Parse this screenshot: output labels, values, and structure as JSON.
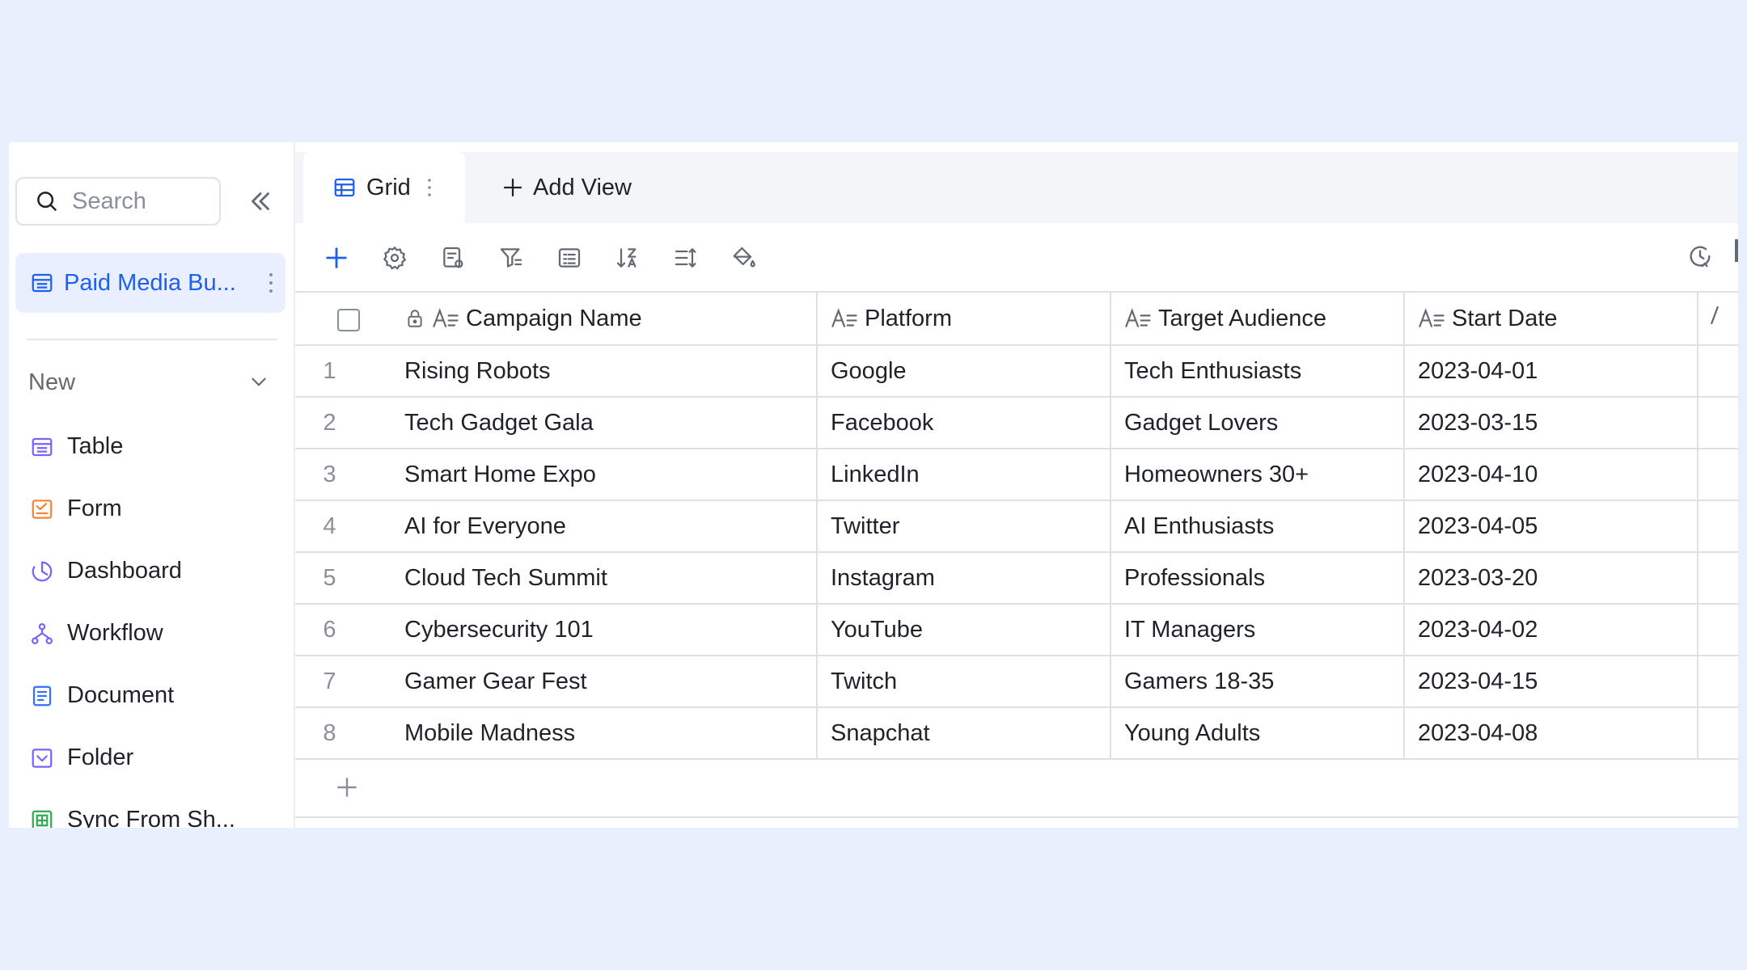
{
  "sidebar": {
    "search_placeholder": "Search",
    "base_name": "Paid Media Bu...",
    "new_label": "New",
    "new_items": [
      {
        "label": "Table",
        "icon": "table-icon",
        "color": "#7b61ff"
      },
      {
        "label": "Form",
        "icon": "form-icon",
        "color": "#f5843b"
      },
      {
        "label": "Dashboard",
        "icon": "dashboard-icon",
        "color": "#7b61ff"
      },
      {
        "label": "Workflow",
        "icon": "workflow-icon",
        "color": "#7b61ff"
      },
      {
        "label": "Document",
        "icon": "document-icon",
        "color": "#3370ff"
      },
      {
        "label": "Folder",
        "icon": "folder-icon",
        "color": "#7b61ff"
      },
      {
        "label": "Sync From Sh...",
        "icon": "sheet-sync-icon",
        "color": "#34a853"
      }
    ]
  },
  "tabs": {
    "grid_label": "Grid",
    "add_view_label": "Add View"
  },
  "colors": {
    "accent": "#1f5ff0",
    "accent_bg": "#e9effe",
    "page_bg": "#e8effd",
    "border": "#dee0e3"
  },
  "grid": {
    "columns": [
      "Campaign Name",
      "Platform",
      "Target Audience",
      "Start Date"
    ],
    "rows": [
      {
        "num": "1",
        "name": "Rising Robots",
        "platform": "Google",
        "audience": "Tech Enthusiasts",
        "date": "2023-04-01"
      },
      {
        "num": "2",
        "name": "Tech Gadget Gala",
        "platform": "Facebook",
        "audience": "Gadget Lovers",
        "date": "2023-03-15"
      },
      {
        "num": "3",
        "name": "Smart Home Expo",
        "platform": "LinkedIn",
        "audience": "Homeowners 30+",
        "date": "2023-04-10"
      },
      {
        "num": "4",
        "name": "AI for Everyone",
        "platform": "Twitter",
        "audience": "AI Enthusiasts",
        "date": "2023-04-05"
      },
      {
        "num": "5",
        "name": "Cloud Tech Summit",
        "platform": "Instagram",
        "audience": "Professionals",
        "date": "2023-03-20"
      },
      {
        "num": "6",
        "name": "Cybersecurity 101",
        "platform": "YouTube",
        "audience": "IT Managers",
        "date": "2023-04-02"
      },
      {
        "num": "7",
        "name": "Gamer Gear Fest",
        "platform": "Twitch",
        "audience": "Gamers 18-35",
        "date": "2023-04-15"
      },
      {
        "num": "8",
        "name": "Mobile Madness",
        "platform": "Snapchat",
        "audience": "Young Adults",
        "date": "2023-04-08"
      }
    ]
  }
}
